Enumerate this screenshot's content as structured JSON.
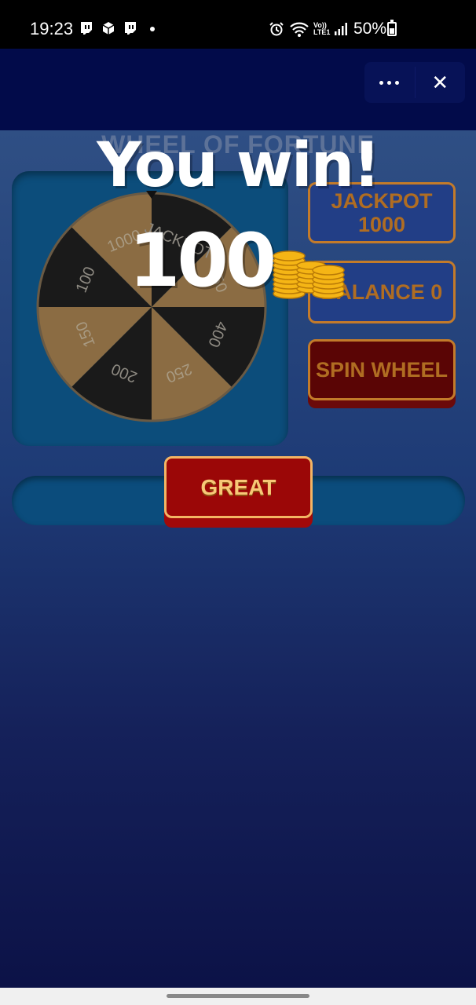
{
  "status_bar": {
    "time": "19:23",
    "left_icons": [
      "twitch-icon",
      "box-icon",
      "twitch-icon",
      "dot-icon"
    ],
    "right_icons": [
      "alarm-icon",
      "wifi-icon",
      "volte-icon",
      "signal-icon"
    ],
    "volte_label": "Vo))\nLTE1",
    "battery_percent": "50%",
    "battery_level": 0.5
  },
  "app_bar": {
    "more_icon": "more-horizontal-icon",
    "close_icon": "close-icon",
    "close_glyph": "✕"
  },
  "game": {
    "title": "WHEEL OF FORTUNE",
    "wheel": {
      "segments": [
        "JACKPOT",
        "750",
        "400",
        "250",
        "200",
        "150",
        "100",
        "1000"
      ],
      "colors": {
        "dark": "#1a1a1a",
        "gold": "#8b6c43"
      }
    },
    "jackpot_label": "JACKPOT\n1000",
    "balance_label": "BALANCE 0",
    "spin_label": "SPIN WHEEL",
    "great_label": "GREAT"
  },
  "win_overlay": {
    "headline": "You win!",
    "amount": "100",
    "reward_icon": "coins-icon"
  }
}
